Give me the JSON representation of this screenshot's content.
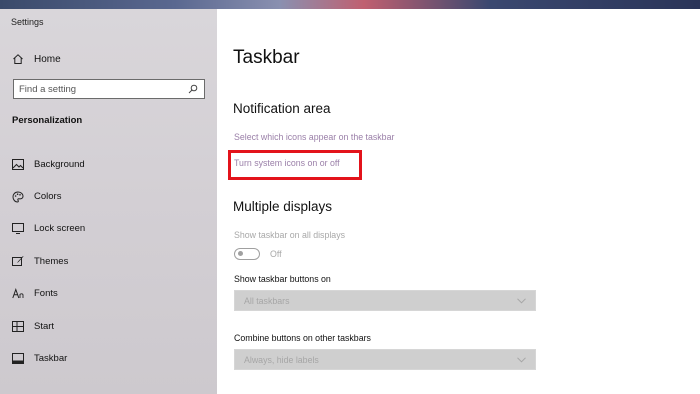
{
  "window": {
    "title": "Settings"
  },
  "sidebar": {
    "home_label": "Home",
    "search_placeholder": "Find a setting",
    "section_title": "Personalization",
    "items": [
      {
        "label": "Background",
        "icon": "picture-icon"
      },
      {
        "label": "Colors",
        "icon": "palette-icon"
      },
      {
        "label": "Lock screen",
        "icon": "monitor-icon"
      },
      {
        "label": "Themes",
        "icon": "brush-icon"
      },
      {
        "label": "Fonts",
        "icon": "font-icon"
      },
      {
        "label": "Start",
        "icon": "start-grid-icon"
      },
      {
        "label": "Taskbar",
        "icon": "taskbar-icon",
        "selected": true
      }
    ]
  },
  "main": {
    "title": "Taskbar",
    "notification_area": {
      "heading": "Notification area",
      "link_select_icons": "Select which icons appear on the taskbar",
      "link_system_icons": "Turn system icons on or off"
    },
    "multiple_displays": {
      "heading": "Multiple displays",
      "show_taskbar_label": "Show taskbar on all displays",
      "toggle_state": "Off",
      "show_buttons_label": "Show taskbar buttons on",
      "show_buttons_value": "All taskbars",
      "combine_label": "Combine buttons on other taskbars",
      "combine_value": "Always, hide labels"
    }
  },
  "colors": {
    "highlight_box": "#e3131b",
    "link": "#9a7fa8",
    "disabled_text": "#a8a8a8"
  }
}
